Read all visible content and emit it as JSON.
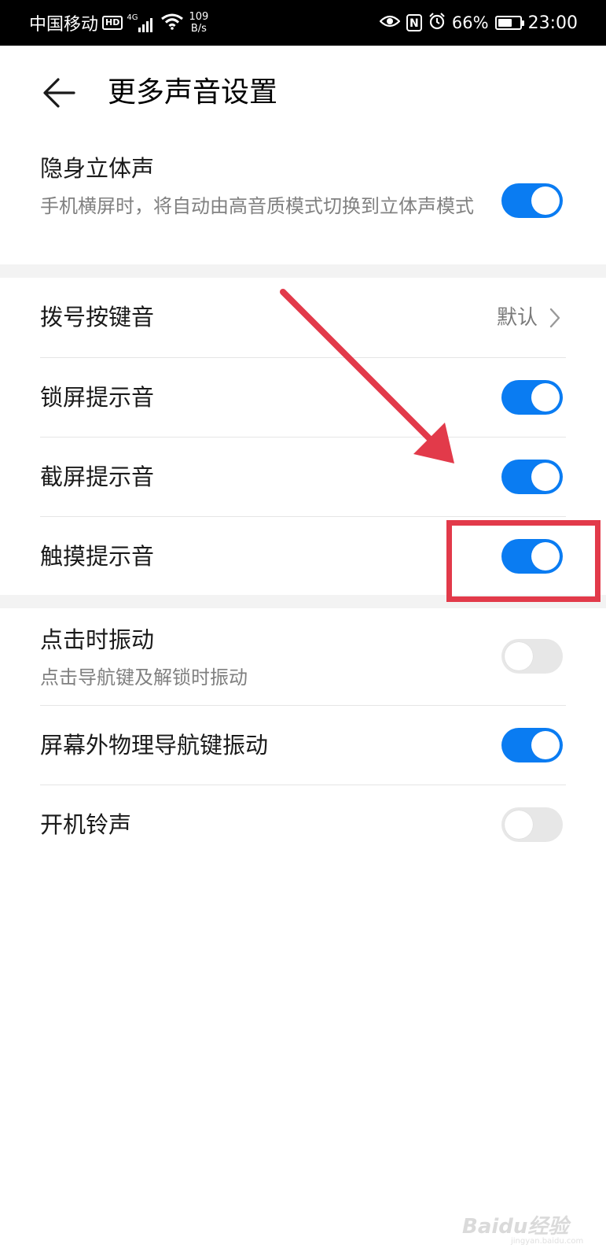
{
  "status_bar": {
    "carrier": "中国移动",
    "hd_badge": "HD",
    "network_type": "4G",
    "speed_value": "109",
    "speed_unit": "B/s",
    "nfc_label": "N",
    "battery_percent": "66%",
    "battery_level": 0.66,
    "time": "23:00"
  },
  "header": {
    "title": "更多声音设置"
  },
  "settings": {
    "stealth_stereo": {
      "title": "隐身立体声",
      "subtitle": "手机横屏时，将自动由高音质模式切换到立体声模式",
      "enabled": true
    },
    "dial_tone": {
      "title": "拨号按键音",
      "value": "默认"
    },
    "lock_sound": {
      "title": "锁屏提示音",
      "enabled": true
    },
    "screenshot_sound": {
      "title": "截屏提示音",
      "enabled": true
    },
    "touch_sound": {
      "title": "触摸提示音",
      "enabled": true
    },
    "vibrate_on_tap": {
      "title": "点击时振动",
      "subtitle": "点击导航键及解锁时振动",
      "enabled": false
    },
    "physical_nav_vibrate": {
      "title": "屏幕外物理导航键振动",
      "enabled": true
    },
    "boot_sound": {
      "title": "开机铃声",
      "enabled": false
    }
  },
  "colors": {
    "toggle_on": "#0a7cf2",
    "toggle_off": "#e7e7e7",
    "annotation": "#e23a4a"
  },
  "watermark": {
    "brand": "Baidu经验",
    "url": "jingyan.baidu.com"
  }
}
